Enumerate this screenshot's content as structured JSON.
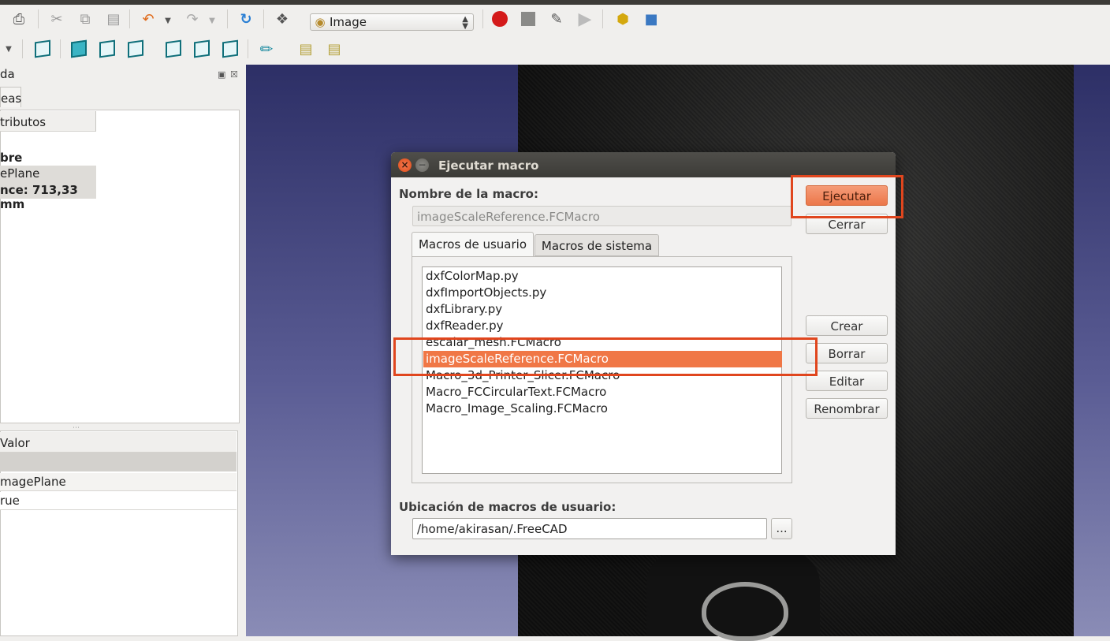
{
  "toolbar": {
    "workbench_selector": "Image",
    "icons": [
      "print-icon",
      "cut-icon",
      "copy-icon",
      "paste-icon",
      "undo-icon",
      "redo-icon",
      "refresh-icon",
      "whats-this-icon",
      "record-macro-icon",
      "stop-macro-icon",
      "edit-macro-icon",
      "run-macro-icon",
      "part-icon",
      "folder-icon"
    ]
  },
  "left_panel": {
    "title_fragment": "da",
    "tab_fragment": "eas",
    "tree_header": "tributos",
    "tree_rows": [
      "bre",
      "ePlane",
      "nce: 713,33 mm"
    ],
    "props_header": "Valor",
    "props_rows": [
      "magePlane",
      "rue"
    ]
  },
  "dialog": {
    "title": "Ejecutar macro",
    "name_label": "Nombre de la macro:",
    "name_value": "imageScaleReference.FCMacro",
    "tabs": [
      "Macros de usuario",
      "Macros de sistema"
    ],
    "macros": [
      "dxfColorMap.py",
      "dxfImportObjects.py",
      "dxfLibrary.py",
      "dxfReader.py",
      "escalar_mesh.FCMacro",
      "imageScaleReference.FCMacro",
      "Macro_3d_Printer_Slicer.FCMacro",
      "Macro_FCCircularText.FCMacro",
      "Macro_Image_Scaling.FCMacro"
    ],
    "selected_index": 5,
    "buttons": {
      "execute": "Ejecutar",
      "close": "Cerrar",
      "create": "Crear",
      "delete": "Borrar",
      "edit": "Editar",
      "rename": "Renombrar"
    },
    "location_label": "Ubicación de macros de usuario:",
    "location_value": "/home/akirasan/.FreeCAD",
    "browse_label": "..."
  },
  "colors": {
    "accent": "#f07746",
    "annotation": "#e0461e"
  }
}
